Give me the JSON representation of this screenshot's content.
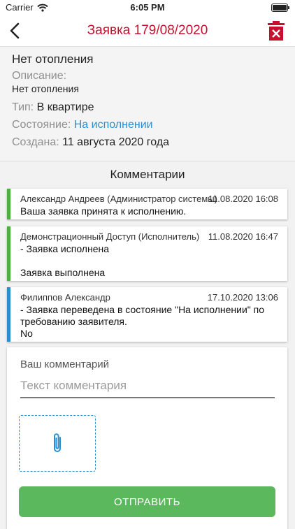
{
  "status_bar": {
    "carrier": "Carrier",
    "time": "6:05 PM",
    "wifi_icon": "wifi-icon",
    "battery_icon": "battery-icon"
  },
  "nav": {
    "title": "Заявка 179/08/2020",
    "back_icon": "chevron-left-icon",
    "delete_icon": "trash-icon",
    "title_color": "#c8102e"
  },
  "request": {
    "title": "Нет отопления",
    "description_label": "Описание:",
    "description": "Нет отопления",
    "type_label": "Тип:",
    "type": "В квартире",
    "state_label": "Состояние:",
    "state": "На исполнении",
    "created_label": "Создана:",
    "created": "11 августа 2020 года"
  },
  "comments": {
    "title": "Комментарии",
    "items": [
      {
        "author": "Александр Андреев (Администратор системы)",
        "date": "11.08.2020 16:08",
        "text": "Ваша заявка принята к исполнению.",
        "accent": "#4caf3f"
      },
      {
        "author": "Демонстрационный Доступ (Исполнитель)",
        "date": "11.08.2020 16:47",
        "text": "- Заявка исполнена\n\nЗаявка выполнена",
        "accent": "#4caf3f"
      },
      {
        "author": "Филиппов Александр",
        "date": "17.10.2020 13:06",
        "text": "- Заявка переведена в состояние \"На исполнении\" по требованию заявителя.\nNo",
        "accent": "#2a8fd1"
      }
    ]
  },
  "form": {
    "label": "Ваш комментарий",
    "placeholder": "Текст комментария",
    "attach_icon": "paperclip-icon",
    "send_label": "ОТПРАВИТЬ",
    "send_color": "#5cb85c"
  }
}
